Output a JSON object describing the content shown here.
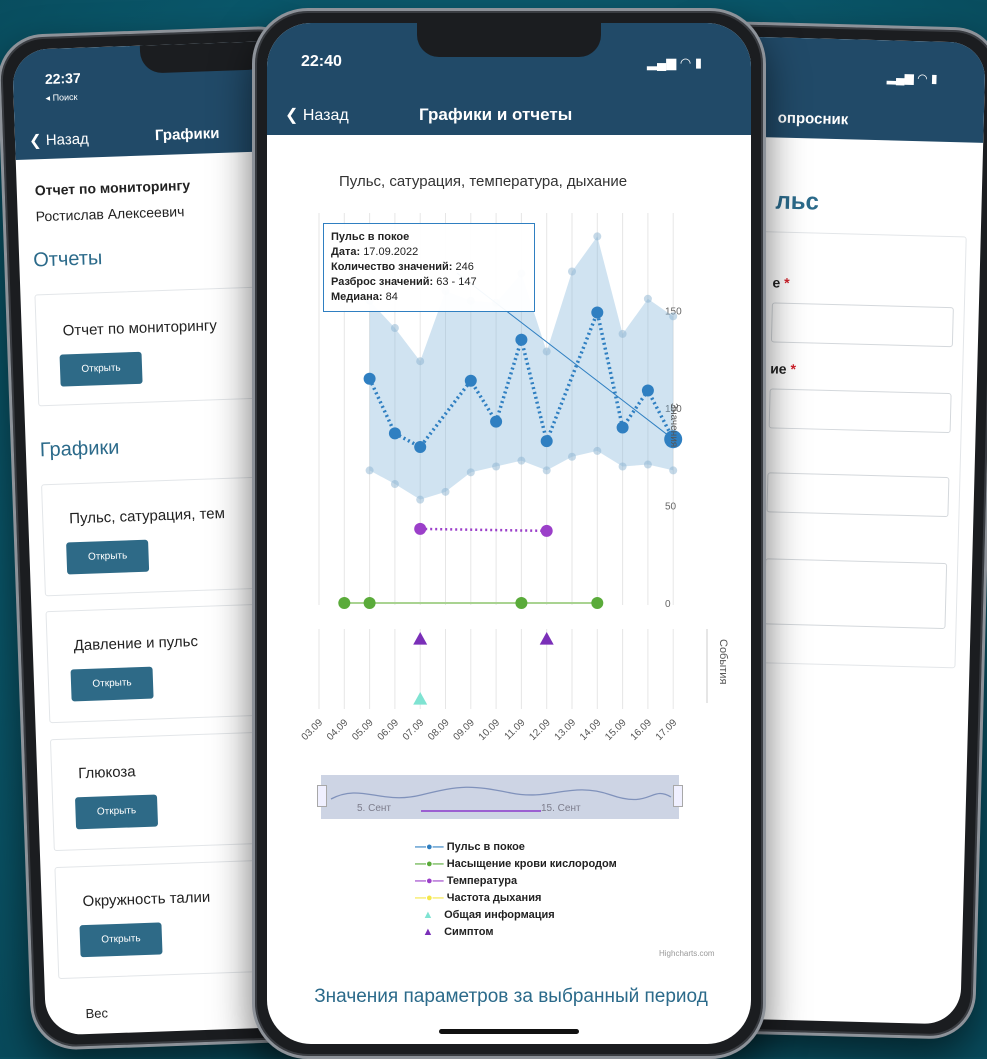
{
  "left_phone": {
    "status_time": "22:37",
    "back_app": "◂ Поиск",
    "nav_back": "Назад",
    "nav_title": "Графики",
    "report_title_line1": "Отчет по мониторингу",
    "report_title_line2": "Ростислав Алексеевич",
    "section_reports": "Отчеты",
    "section_graphs": "Графики",
    "open_label": "Открыть",
    "cards": [
      {
        "title": "Отчет по мониторингу"
      },
      {
        "title": "Пульс, сатурация, тем"
      },
      {
        "title": "Давление и пульс"
      },
      {
        "title": "Глюкоза"
      },
      {
        "title": "Окружность талии"
      },
      {
        "title": "Вес"
      }
    ]
  },
  "right_phone": {
    "nav_title": "опросник",
    "heading": "льс",
    "field1_label": "е",
    "field2_label": "ие",
    "required_mark": "*"
  },
  "center_phone": {
    "status_time": "22:40",
    "nav_back": "Назад",
    "nav_title": "Графики и отчеты",
    "chart_title": "Пульс, сатурация, температура, дыхание",
    "tooltip": {
      "title": "Пульс в покое",
      "date_label": "Дата:",
      "date_value": "17.09.2022",
      "count_label": "Количество значений:",
      "count_value": "246",
      "range_label": "Разброс значений:",
      "range_value": "63 - 147",
      "median_label": "Медиана:",
      "median_value": "84"
    },
    "y_axis_label": "Значения",
    "events_axis_label": "События",
    "navigator_start": "5. Сент",
    "navigator_end": "15. Сент",
    "credits": "Highcharts.com",
    "section_title": "Значения параметров за выбранный период",
    "colors": {
      "pulse": "#2f7fc1",
      "saturation": "#5aab3a",
      "temperature": "#9b3fc9",
      "resp": "#f5e74a",
      "general": "#7fe3d2",
      "symptom": "#7a2fb8"
    }
  },
  "chart_data": {
    "type": "line",
    "title": "Пульс, сатурация, температура, дыхание",
    "ylabel": "Значения",
    "ylim": [
      0,
      180
    ],
    "yticks": [
      "0",
      "50",
      "100",
      "150"
    ],
    "categories": [
      "03.09",
      "04.09",
      "05.09",
      "06.09",
      "07.09",
      "08.09",
      "09.09",
      "10.09",
      "11.09",
      "12.09",
      "13.09",
      "14.09",
      "15.09",
      "16.09",
      "17.09"
    ],
    "series": [
      {
        "name": "Пульс в покое",
        "points": [
          [
            2,
            115
          ],
          [
            3,
            87
          ],
          [
            4,
            80
          ],
          [
            6,
            114
          ],
          [
            7,
            93
          ],
          [
            8,
            135
          ],
          [
            9,
            83
          ],
          [
            11,
            149
          ],
          [
            12,
            90
          ],
          [
            13,
            109
          ],
          [
            14,
            84
          ]
        ]
      },
      {
        "name": "Пульс в покое (мин)",
        "points": [
          [
            2,
            68
          ],
          [
            3,
            61
          ],
          [
            4,
            53
          ],
          [
            5,
            57
          ],
          [
            6,
            67
          ],
          [
            7,
            70
          ],
          [
            8,
            73
          ],
          [
            9,
            68
          ],
          [
            10,
            75
          ],
          [
            11,
            78
          ],
          [
            12,
            70
          ],
          [
            13,
            71
          ],
          [
            14,
            68
          ]
        ]
      },
      {
        "name": "Пульс в покое (макс)",
        "points": [
          [
            2,
            155
          ],
          [
            3,
            141
          ],
          [
            4,
            124
          ],
          [
            5,
            160
          ],
          [
            6,
            155
          ],
          [
            7,
            154
          ],
          [
            8,
            169
          ],
          [
            9,
            129
          ],
          [
            10,
            170
          ],
          [
            11,
            188
          ],
          [
            12,
            138
          ],
          [
            13,
            156
          ],
          [
            14,
            147
          ]
        ]
      },
      {
        "name": "Насыщение крови кислородом",
        "points": [
          [
            1,
            0
          ],
          [
            2,
            0
          ],
          [
            8,
            0
          ],
          [
            11,
            0
          ]
        ]
      },
      {
        "name": "Температура",
        "points": [
          [
            4,
            38
          ],
          [
            9,
            37
          ]
        ]
      },
      {
        "name": "Симптом",
        "points": [
          [
            4,
            1
          ],
          [
            9,
            1
          ]
        ]
      },
      {
        "name": "Общая информация",
        "points": [
          [
            4,
            0
          ]
        ]
      }
    ],
    "legend": [
      {
        "label": "Пульс в покое",
        "marker": "circle",
        "color": "#2f7fc1"
      },
      {
        "label": "Насыщение крови кислородом",
        "marker": "circle",
        "color": "#5aab3a"
      },
      {
        "label": "Температура",
        "marker": "circle",
        "color": "#9b3fc9"
      },
      {
        "label": "Частота дыхания",
        "marker": "circle",
        "color": "#f5e74a"
      },
      {
        "label": "Общая информация",
        "marker": "triangle",
        "color": "#7fe3d2"
      },
      {
        "label": "Симптом",
        "marker": "triangle",
        "color": "#7a2fb8"
      }
    ],
    "legend_position": "bottom"
  }
}
